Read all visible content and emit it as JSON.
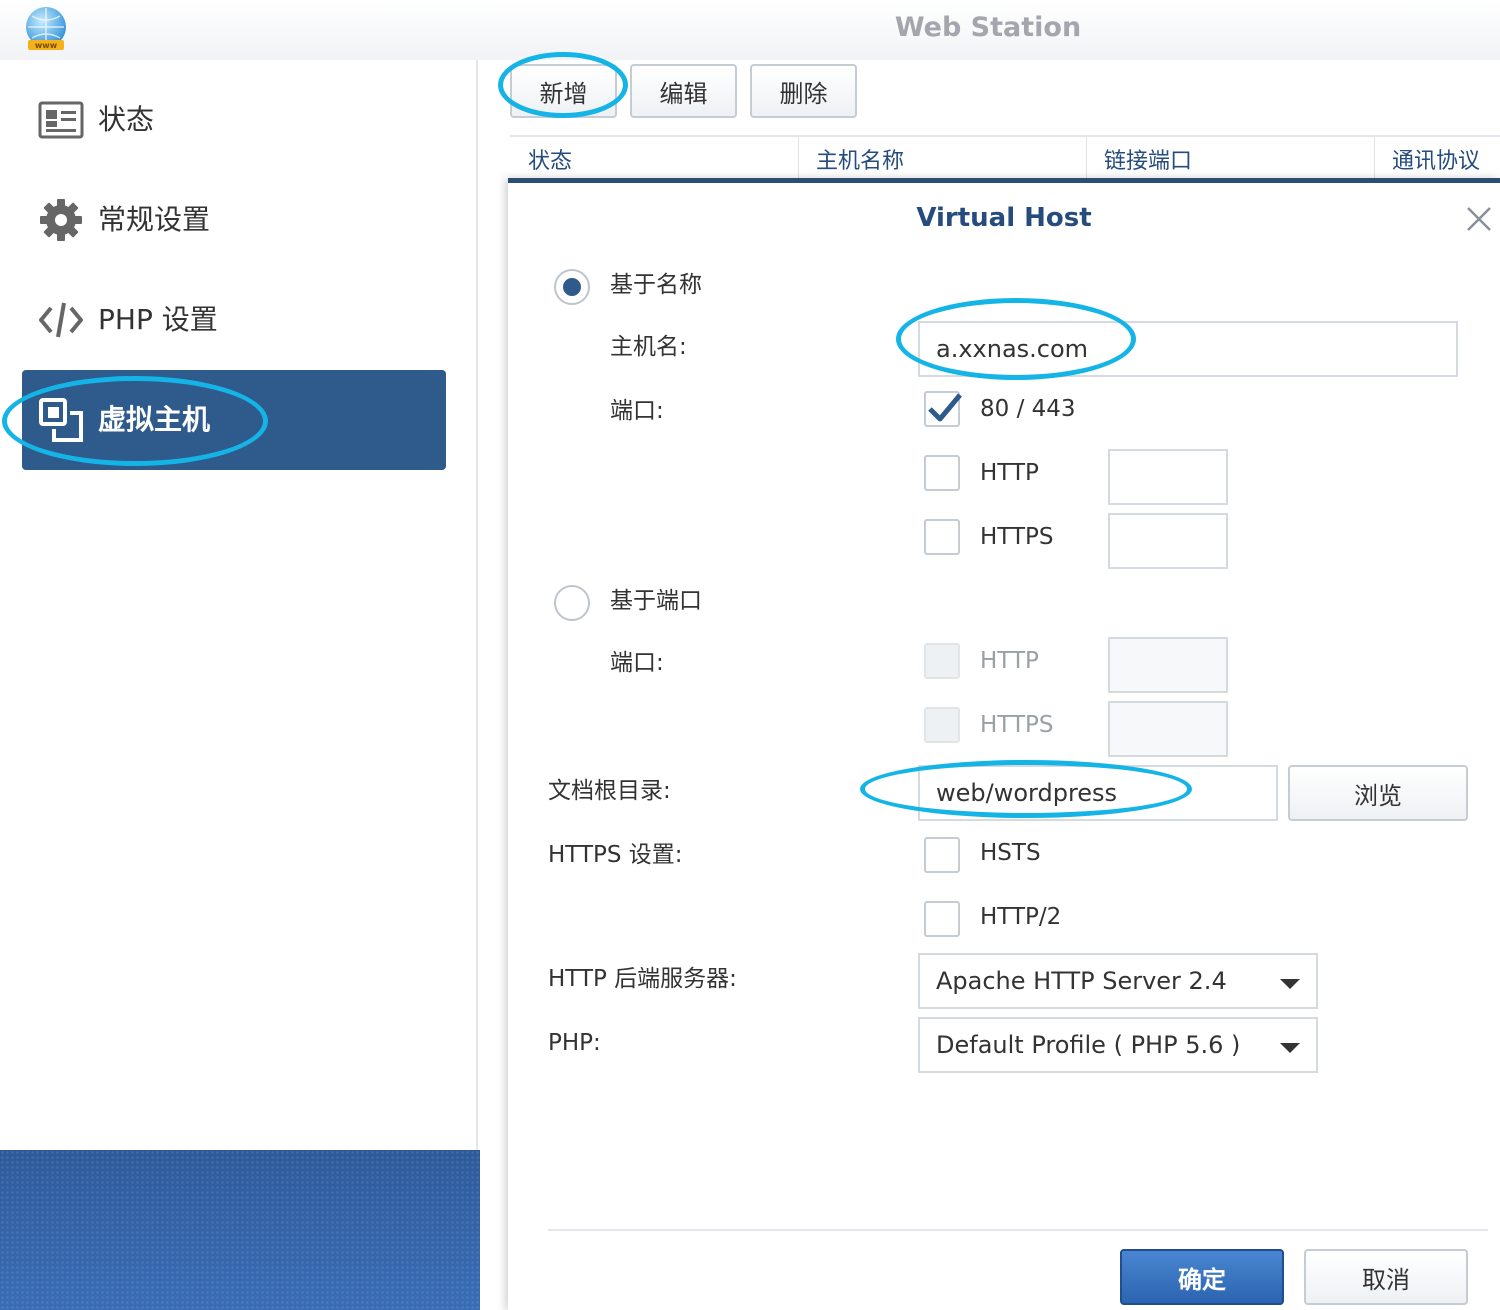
{
  "window": {
    "title": "Web Station"
  },
  "sidebar": {
    "items": [
      {
        "label": "状态",
        "icon": "status-card-icon"
      },
      {
        "label": "常规设置",
        "icon": "gear-icon"
      },
      {
        "label": "PHP 设置",
        "icon": "code-icon"
      },
      {
        "label": "虚拟主机",
        "icon": "virtual-host-icon",
        "active": true
      }
    ]
  },
  "toolbar": {
    "add_label": "新增",
    "edit_label": "编辑",
    "delete_label": "删除"
  },
  "table": {
    "columns": [
      "状态",
      "主机名称",
      "链接端口",
      "通讯协议"
    ]
  },
  "dialog": {
    "title": "Virtual Host",
    "name_based": {
      "label": "基于名称",
      "selected": true,
      "hostname_label": "主机名:",
      "hostname_value": "a.xxnas.com",
      "port_label": "端口:",
      "port_default_label": "80 / 443",
      "port_default_checked": true,
      "http_label": "HTTP",
      "https_label": "HTTPS"
    },
    "port_based": {
      "label": "基于端口",
      "selected": false,
      "port_label": "端口:",
      "http_label": "HTTP",
      "https_label": "HTTPS"
    },
    "doc_root_label": "文档根目录:",
    "doc_root_value": "web/wordpress",
    "browse_label": "浏览",
    "https_settings_label": "HTTPS 设置:",
    "hsts_label": "HSTS",
    "http2_label": "HTTP/2",
    "backend_label": "HTTP 后端服务器:",
    "backend_value": "Apache HTTP Server 2.4",
    "php_label": "PHP:",
    "php_value": "Default Profile ( PHP 5.6 )",
    "ok_label": "确定",
    "cancel_label": "取消"
  },
  "colors": {
    "accent": "#2f5a8c",
    "annotation": "#14b5e6",
    "primary_button": "#2b64b0"
  }
}
